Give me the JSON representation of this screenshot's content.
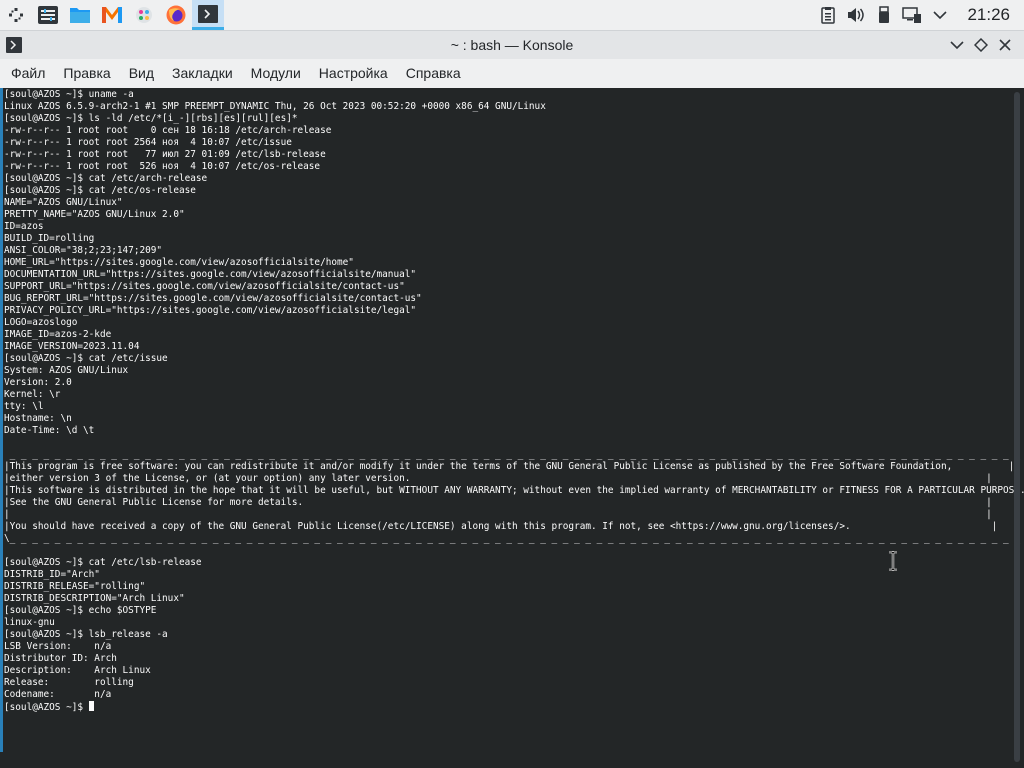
{
  "panel": {
    "launchers": [
      {
        "name": "app-launcher-icon"
      },
      {
        "name": "system-settings-icon"
      },
      {
        "name": "file-manager-icon"
      },
      {
        "name": "app-store-icon"
      },
      {
        "name": "colorful-app-icon"
      },
      {
        "name": "firefox-icon"
      },
      {
        "name": "konsole-icon"
      }
    ],
    "clock": "21:26"
  },
  "window": {
    "title": "~ : bash — Konsole"
  },
  "menubar": {
    "items": [
      "Файл",
      "Правка",
      "Вид",
      "Закладки",
      "Модули",
      "Настройка",
      "Справка"
    ]
  },
  "terminal": {
    "lines": [
      "[soul@AZOS ~]$ uname -a",
      "Linux AZOS 6.5.9-arch2-1 #1 SMP PREEMPT_DYNAMIC Thu, 26 Oct 2023 00:52:20 +0000 x86_64 GNU/Linux",
      "[soul@AZOS ~]$ ls -ld /etc/*[i_-][rbs][es][rul][es]*",
      "-rw-r--r-- 1 root root    0 сен 18 16:18 /etc/arch-release",
      "-rw-r--r-- 1 root root 2564 ноя  4 10:07 /etc/issue",
      "-rw-r--r-- 1 root root   77 июл 27 01:09 /etc/lsb-release",
      "-rw-r--r-- 1 root root  526 ноя  4 10:07 /etc/os-release",
      "[soul@AZOS ~]$ cat /etc/arch-release",
      "[soul@AZOS ~]$ cat /etc/os-release",
      "NAME=\"AZOS GNU/Linux\"",
      "PRETTY_NAME=\"AZOS GNU/Linux 2.0\"",
      "ID=azos",
      "BUILD_ID=rolling",
      "ANSI_COLOR=\"38;2;23;147;209\"",
      "HOME_URL=\"https://sites.google.com/view/azosofficialsite/home\"",
      "DOCUMENTATION_URL=\"https://sites.google.com/view/azosofficialsite/manual\"",
      "SUPPORT_URL=\"https://sites.google.com/view/azosofficialsite/contact-us\"",
      "BUG_REPORT_URL=\"https://sites.google.com/view/azosofficialsite/contact-us\"",
      "PRIVACY_POLICY_URL=\"https://sites.google.com/view/azosofficialsite/legal\"",
      "LOGO=azoslogo",
      "IMAGE_ID=azos-2-kde",
      "IMAGE_VERSION=2023.11.04",
      "[soul@AZOS ~]$ cat /etc/issue",
      "System: AZOS GNU/Linux",
      "Version: 2.0",
      "Kernel: \\r",
      "tty: \\l",
      "Hostname: \\n",
      "Date-Time: \\d \\t",
      "",
      " _ _ _ _ _ _ _ _ _ _ _ _ _ _ _ _ _ _ _ _ _ _ _ _ _ _ _ _ _ _ _ _ _ _ _ _ _ _ _ _ _ _ _ _ _ _ _ _ _ _ _ _ _ _ _ _ _ _ _ _ _ _ _ _ _ _ _ _ _ _ _ _ _ _ _ _ _ _ _ _ _ _ _ _ _ _ _ _ _ _ _ _ _ _ ",
      "|This program is free software: you can redistribute it and/or modify it under the terms of the GNU General Public License as published by the Free Software Foundation,          |",
      "|either version 3 of the License, or (at your option) any later version.                                                                                                      |",
      "|This software is distributed in the hope that it will be useful, but WITHOUT ANY WARRANTY; without even the implied warranty of MERCHANTABILITY or FITNESS FOR A PARTICULAR PURPOSE.  |",
      "|See the GNU General Public License for more details.                                                                                                                         |",
      "|                                                                                                                                                                             |",
      "|You should have received a copy of the GNU General Public License(/etc/LICENSE) along with this program. If not, see <https://www.gnu.org/licenses/>.                         |",
      "\\_ _ _ _ _ _ _ _ _ _ _ _ _ _ _ _ _ _ _ _ _ _ _ _ _ _ _ _ _ _ _ _ _ _ _ _ _ _ _ _ _ _ _ _ _ _ _ _ _ _ _ _ _ _ _ _ _ _ _ _ _ _ _ _ _ _ _ _ _ _ _ _ _ _ _ _ _ _ _ _ _ _ _ _ _ _ _ _ _ _ _ _ _ _/",
      "",
      "[soul@AZOS ~]$ cat /etc/lsb-release",
      "DISTRIB_ID=\"Arch\"",
      "DISTRIB_RELEASE=\"rolling\"",
      "DISTRIB_DESCRIPTION=\"Arch Linux\"",
      "[soul@AZOS ~]$ echo $OSTYPE",
      "linux-gnu",
      "[soul@AZOS ~]$ lsb_release -a",
      "LSB Version:    n/a",
      "Distributor ID: Arch",
      "Description:    Arch Linux",
      "Release:        rolling",
      "Codename:       n/a"
    ],
    "prompt": "[soul@AZOS ~]$ "
  },
  "colors": {
    "accent": "#3daee9",
    "terminal_bg": "#232627",
    "terminal_fg": "#fcfcfc"
  }
}
